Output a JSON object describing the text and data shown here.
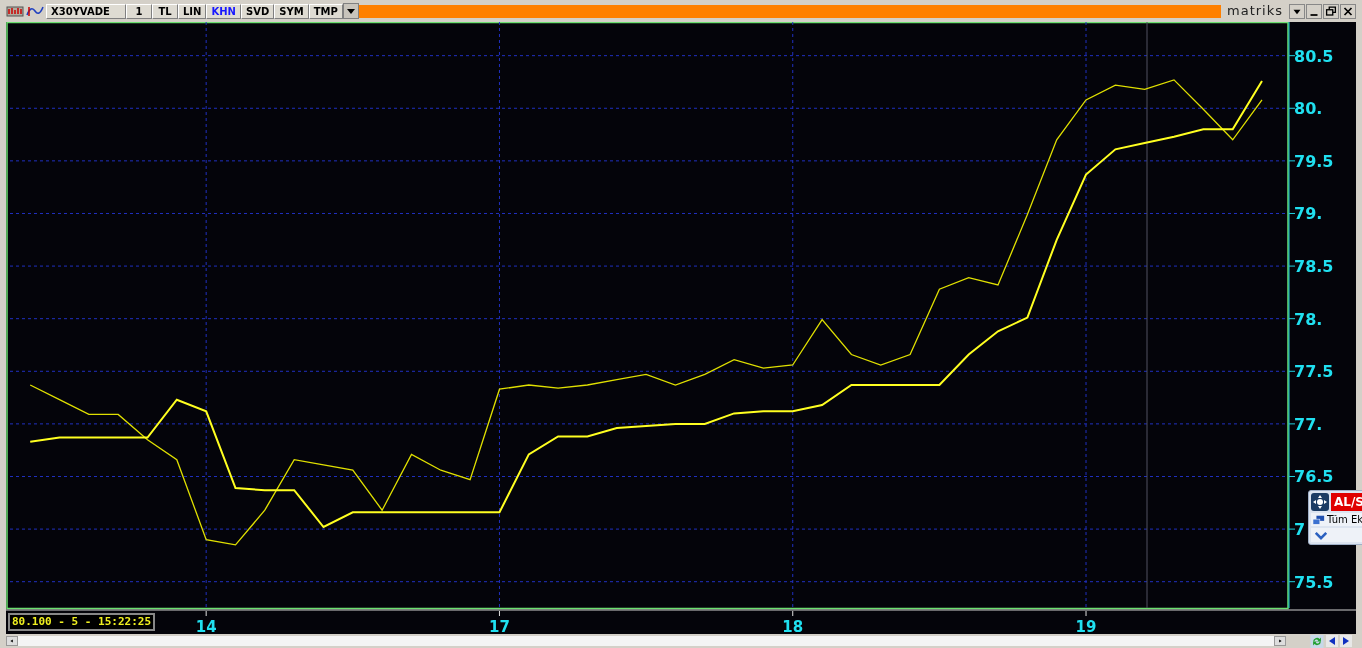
{
  "toolbar": {
    "items": [
      {
        "label": "X30YVADE",
        "selected": false
      },
      {
        "label": "1",
        "selected": false
      },
      {
        "label": "TL",
        "selected": false
      },
      {
        "label": "LIN",
        "selected": false
      },
      {
        "label": "KHN",
        "selected": true
      },
      {
        "label": "SVD",
        "selected": false
      },
      {
        "label": "SYM",
        "selected": false
      },
      {
        "label": "TMP",
        "selected": false
      }
    ]
  },
  "logo": "matriks",
  "chart": {
    "chart_data": {
      "type": "line",
      "grid": true,
      "categories": [
        null,
        null,
        null,
        null,
        null,
        null,
        "14",
        null,
        null,
        null,
        null,
        null,
        null,
        null,
        null,
        null,
        "17",
        null,
        null,
        null,
        null,
        null,
        null,
        null,
        null,
        null,
        "18",
        null,
        null,
        null,
        null,
        null,
        null,
        null,
        null,
        null,
        "19",
        null,
        null,
        null,
        null,
        null,
        null
      ],
      "series": [
        {
          "color": "#e0e000",
          "values": [
            77.37,
            77.23,
            77.09,
            77.09,
            76.85,
            76.66,
            75.9,
            75.85,
            76.18,
            76.66,
            76.61,
            76.56,
            76.18,
            76.71,
            76.56,
            76.47,
            77.33,
            77.37,
            77.34,
            77.37,
            77.42,
            77.47,
            77.37,
            77.47,
            77.61,
            77.53,
            77.56,
            77.99,
            77.66,
            77.56,
            77.66,
            78.28,
            78.39,
            78.32,
            78.99,
            79.7,
            80.08,
            80.22,
            80.18,
            80.27,
            79.99,
            79.7,
            80.08
          ]
        },
        {
          "color": "#ffff20",
          "values": [
            76.83,
            76.87,
            76.87,
            76.87,
            76.87,
            77.23,
            77.12,
            76.39,
            76.37,
            76.37,
            76.02,
            76.16,
            76.16,
            76.16,
            76.16,
            76.16,
            76.16,
            76.71,
            76.88,
            76.88,
            76.96,
            76.98,
            77.0,
            77.0,
            77.1,
            77.12,
            77.12,
            77.18,
            77.37,
            77.37,
            77.37,
            77.37,
            77.66,
            77.88,
            78.01,
            78.75,
            79.37,
            79.61,
            79.67,
            79.73,
            79.8,
            79.8,
            80.26
          ]
        }
      ],
      "ylim": [
        75.25,
        80.82
      ],
      "yticks": [
        {
          "value": 75.5,
          "label": "75.5"
        },
        {
          "value": 76.5,
          "label": "76.5"
        },
        {
          "value": 77,
          "label": "77."
        },
        {
          "value": 77.5,
          "label": "77.5"
        },
        {
          "value": 78,
          "label": "78."
        },
        {
          "value": 78.5,
          "label": "78.5"
        },
        {
          "value": 79,
          "label": "79."
        },
        {
          "value": 79.5,
          "label": "79.5"
        },
        {
          "value": 80,
          "label": "80."
        },
        {
          "value": 80.5,
          "label": "80.5"
        }
      ]
    }
  },
  "covered_axis_label": "7",
  "status_readout": "80.100 - 5 - 15:22:25",
  "popup": {
    "title": "AL/S",
    "item": "Tüm Ek"
  }
}
